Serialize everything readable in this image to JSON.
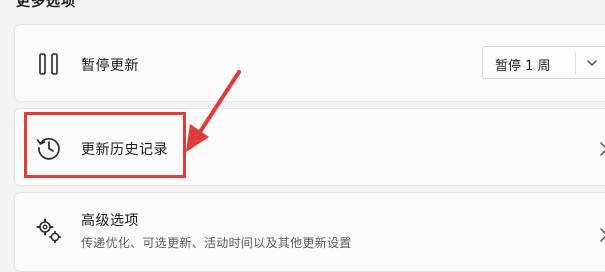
{
  "section": {
    "title": "更多选项"
  },
  "pause_updates": {
    "icon": "pause-icon",
    "label": "暂停更新",
    "dropdown_value": "暂停 1 周"
  },
  "update_history": {
    "icon": "history-clock-icon",
    "label": "更新历史记录"
  },
  "advanced_options": {
    "icon": "gears-icon",
    "label": "高级选项",
    "description": "传递优化、可选更新、活动时间以及其他更新设置"
  },
  "annotation": {
    "highlight_color": "#e03a3a"
  }
}
